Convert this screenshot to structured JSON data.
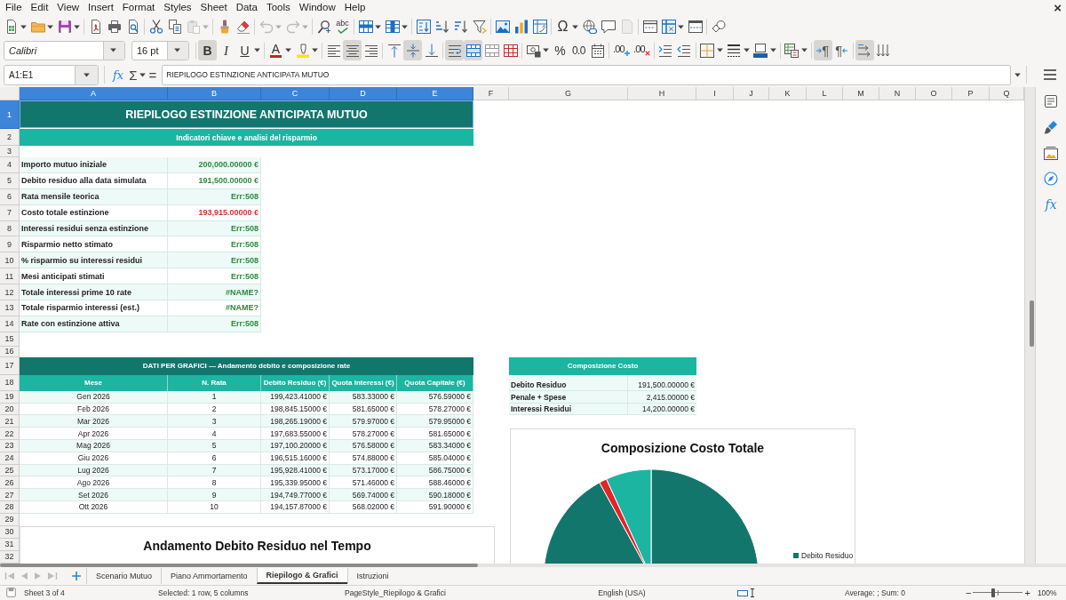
{
  "menu": {
    "items": [
      "File",
      "Edit",
      "View",
      "Insert",
      "Format",
      "Styles",
      "Sheet",
      "Data",
      "Tools",
      "Window",
      "Help"
    ],
    "close": "×"
  },
  "standard_toolbar": {
    "groups": [
      [
        {
          "kind": "new",
          "dropdown": true,
          "disabled": false
        },
        {
          "kind": "open",
          "dropdown": true,
          "disabled": false
        },
        {
          "kind": "save",
          "dropdown": true,
          "disabled": false
        }
      ],
      [
        {
          "kind": "pdf",
          "dropdown": false,
          "disabled": false
        },
        {
          "kind": "print",
          "dropdown": false,
          "disabled": false
        },
        {
          "kind": "preview",
          "dropdown": false,
          "disabled": false
        }
      ],
      [
        {
          "kind": "cut",
          "dropdown": false,
          "disabled": false
        },
        {
          "kind": "copy",
          "dropdown": false,
          "disabled": false
        },
        {
          "kind": "paste",
          "dropdown": true,
          "disabled": true
        }
      ],
      [
        {
          "kind": "clone",
          "dropdown": false,
          "disabled": false
        },
        {
          "kind": "clear",
          "dropdown": false,
          "disabled": false
        }
      ],
      [
        {
          "kind": "undo",
          "dropdown": true,
          "disabled": true
        },
        {
          "kind": "redo",
          "dropdown": true,
          "disabled": true
        }
      ],
      [
        {
          "kind": "find",
          "dropdown": false,
          "disabled": false
        },
        {
          "kind": "spell",
          "glyph": "abc",
          "dropdown": false,
          "disabled": false
        }
      ],
      [
        {
          "kind": "rows",
          "dropdown": true,
          "disabled": false
        },
        {
          "kind": "columns",
          "dropdown": true,
          "disabled": false
        }
      ],
      [
        {
          "kind": "sort",
          "dropdown": false,
          "disabled": false
        },
        {
          "kind": "sortasc",
          "dropdown": false,
          "disabled": false
        },
        {
          "kind": "sortdesc",
          "dropdown": false,
          "disabled": false
        },
        {
          "kind": "filter",
          "dropdown": false,
          "disabled": false
        }
      ],
      [
        {
          "kind": "image",
          "dropdown": false,
          "disabled": false
        },
        {
          "kind": "chart",
          "dropdown": false,
          "disabled": false
        },
        {
          "kind": "pivot",
          "dropdown": false,
          "disabled": false
        }
      ],
      [
        {
          "kind": "special",
          "glyph": "Ω",
          "dropdown": true,
          "disabled": false
        },
        {
          "kind": "link",
          "dropdown": false,
          "disabled": false
        },
        {
          "kind": "comment",
          "dropdown": false,
          "disabled": false
        },
        {
          "kind": "headerfooter",
          "dropdown": false,
          "disabled": true
        }
      ],
      [
        {
          "kind": "printarea",
          "dropdown": false,
          "disabled": false
        },
        {
          "kind": "freeze",
          "dropdown": true,
          "disabled": false
        },
        {
          "kind": "split",
          "dropdown": false,
          "disabled": false
        }
      ],
      [
        {
          "kind": "draw",
          "dropdown": false,
          "disabled": false
        }
      ]
    ]
  },
  "format_toolbar": {
    "font_name": "Calibri",
    "font_size": "16 pt",
    "groups": [
      [
        {
          "kind": "bold",
          "glyph": "B",
          "dropdown": false,
          "pressed": true
        },
        {
          "kind": "italic",
          "glyph": "I",
          "dropdown": false,
          "pressed": false
        },
        {
          "kind": "underline",
          "glyph": "U",
          "dropdown": true,
          "pressed": false
        }
      ],
      [
        {
          "kind": "fontcolor",
          "glyph": "A",
          "dropdown": true,
          "pressed": false
        },
        {
          "kind": "highlight",
          "dropdown": true,
          "pressed": false
        }
      ],
      [
        {
          "kind": "alignleft",
          "dropdown": false,
          "pressed": false
        },
        {
          "kind": "aligncenter",
          "dropdown": false,
          "pressed": true
        },
        {
          "kind": "alignright",
          "dropdown": false,
          "pressed": false
        }
      ],
      [
        {
          "kind": "aligntop",
          "dropdown": false,
          "pressed": false
        },
        {
          "kind": "alignmiddle",
          "dropdown": false,
          "pressed": true
        },
        {
          "kind": "alignbottom",
          "dropdown": false,
          "pressed": false
        }
      ],
      [
        {
          "kind": "wrap",
          "dropdown": false,
          "pressed": true
        },
        {
          "kind": "mergecenter",
          "dropdown": false,
          "pressed": true
        },
        {
          "kind": "merge",
          "dropdown": false,
          "pressed": false
        },
        {
          "kind": "unmerge",
          "dropdown": false,
          "pressed": false
        }
      ],
      [
        {
          "kind": "currency",
          "dropdown": true,
          "pressed": false
        },
        {
          "kind": "percent",
          "glyph": "%",
          "dropdown": false,
          "pressed": false
        },
        {
          "kind": "standard",
          "glyph": "0.0",
          "dropdown": false,
          "pressed": false
        },
        {
          "kind": "date",
          "dropdown": false,
          "pressed": false
        }
      ],
      [
        {
          "kind": "adddecimal",
          "glyph": ".00",
          "dropdown": false,
          "pressed": false
        },
        {
          "kind": "deletedecimal",
          "glyph": ".00",
          "dropdown": false,
          "pressed": false
        }
      ],
      [
        {
          "kind": "indent",
          "dropdown": false,
          "pressed": false
        },
        {
          "kind": "outdent",
          "dropdown": false,
          "pressed": false
        }
      ],
      [
        {
          "kind": "borders",
          "dropdown": true,
          "pressed": false
        },
        {
          "kind": "borderstyle",
          "dropdown": true,
          "pressed": false
        },
        {
          "kind": "bordercolor",
          "dropdown": true,
          "pressed": false
        }
      ],
      [
        {
          "kind": "conditional",
          "dropdown": true,
          "pressed": false
        }
      ],
      [
        {
          "kind": "ltr",
          "glyph": "¶",
          "dropdown": false,
          "pressed": true
        },
        {
          "kind": "rtl",
          "glyph": "¶",
          "dropdown": false,
          "pressed": false
        }
      ],
      [
        {
          "kind": "textltr",
          "dropdown": false,
          "pressed": true
        },
        {
          "kind": "texttb",
          "dropdown": false,
          "pressed": false
        }
      ]
    ]
  },
  "formula_bar": {
    "cell_reference": "A1:E1",
    "function_wizard": "fx",
    "sum": "Σ",
    "formula": "=",
    "content": "RIEPILOGO ESTINZIONE ANTICIPATA MUTUO"
  },
  "sheet": {
    "columns": [
      {
        "label": "A",
        "selected": true
      },
      {
        "label": "B",
        "selected": true
      },
      {
        "label": "C",
        "selected": true
      },
      {
        "label": "D",
        "selected": true
      },
      {
        "label": "E",
        "selected": true
      },
      {
        "label": "F",
        "selected": false
      },
      {
        "label": "G",
        "selected": false
      },
      {
        "label": "H",
        "selected": false
      },
      {
        "label": "I",
        "selected": false
      },
      {
        "label": "J",
        "selected": false
      },
      {
        "label": "K",
        "selected": false
      },
      {
        "label": "L",
        "selected": false
      },
      {
        "label": "M",
        "selected": false
      },
      {
        "label": "N",
        "selected": false
      },
      {
        "label": "O",
        "selected": false
      },
      {
        "label": "P",
        "selected": false
      },
      {
        "label": "Q",
        "selected": false
      }
    ],
    "rows": [
      {
        "label": "1",
        "selected": true
      },
      {
        "label": "2",
        "selected": false
      },
      {
        "label": "3",
        "selected": false
      },
      {
        "label": "4",
        "selected": false
      },
      {
        "label": "5",
        "selected": false
      },
      {
        "label": "6",
        "selected": false
      },
      {
        "label": "7",
        "selected": false
      },
      {
        "label": "8",
        "selected": false
      },
      {
        "label": "9",
        "selected": false
      },
      {
        "label": "10",
        "selected": false
      },
      {
        "label": "11",
        "selected": false
      },
      {
        "label": "12",
        "selected": false
      },
      {
        "label": "13",
        "selected": false
      },
      {
        "label": "14",
        "selected": false
      },
      {
        "label": "15",
        "selected": false
      },
      {
        "label": "16",
        "selected": false
      },
      {
        "label": "17",
        "selected": false
      },
      {
        "label": "18",
        "selected": false
      },
      {
        "label": "19",
        "selected": false
      },
      {
        "label": "20",
        "selected": false
      },
      {
        "label": "21",
        "selected": false
      },
      {
        "label": "22",
        "selected": false
      },
      {
        "label": "23",
        "selected": false
      },
      {
        "label": "24",
        "selected": false
      },
      {
        "label": "25",
        "selected": false
      },
      {
        "label": "26",
        "selected": false
      },
      {
        "label": "27",
        "selected": false
      },
      {
        "label": "28",
        "selected": false
      },
      {
        "label": "29",
        "selected": false
      },
      {
        "label": "30",
        "selected": false
      },
      {
        "label": "31",
        "selected": false
      },
      {
        "label": "32",
        "selected": false
      }
    ],
    "title": "RIEPILOGO ESTINZIONE ANTICIPATA MUTUO",
    "subtitle": "Indicatori chiave e analisi del risparmio",
    "summary": [
      {
        "label": "Importo mutuo iniziale",
        "value": "200,000.00000 €",
        "color": "#2b8a3e"
      },
      {
        "label": "Debito residuo alla data simulata",
        "value": "191,500.00000 €",
        "color": "#2b8a3e"
      },
      {
        "label": "Rata mensile teorica",
        "value": "Err:508",
        "color": "#2b8a3e"
      },
      {
        "label": "Costo totale estinzione",
        "value": "193,915.00000 €",
        "color": "#d9302c"
      },
      {
        "label": "Interessi residui senza estinzione",
        "value": "Err:508",
        "color": "#2b8a3e"
      },
      {
        "label": "Risparmio netto stimato",
        "value": "Err:508",
        "color": "#2b8a3e"
      },
      {
        "label": "% risparmio su interessi residui",
        "value": "Err:508",
        "color": "#2b8a3e"
      },
      {
        "label": "Mesi anticipati stimati",
        "value": "Err:508",
        "color": "#2b8a3e"
      },
      {
        "label": "Totale interessi prime 10 rate",
        "value": "#NAME?",
        "color": "#2b8a3e"
      },
      {
        "label": "Totale risparmio interessi (est.)",
        "value": "#NAME?",
        "color": "#2b8a3e"
      },
      {
        "label": "Rate con estinzione attiva",
        "value": "Err:508",
        "color": "#2b8a3e"
      }
    ],
    "chart_table": {
      "title": "DATI PER GRAFICI — Andamento debito e composizione rate",
      "columns": [
        "Mese",
        "N. Rata",
        "Debito Residuo (€)",
        "Quota Interessi (€)",
        "Quota Capitale (€)"
      ],
      "rows": [
        [
          "Gen 2026",
          "1",
          "199,423.41000 €",
          "583.33000 €",
          "576.59000 €"
        ],
        [
          "Feb 2026",
          "2",
          "198,845.15000 €",
          "581.65000 €",
          "578.27000 €"
        ],
        [
          "Mar 2026",
          "3",
          "198,265.19000 €",
          "579.97000 €",
          "579.95000 €"
        ],
        [
          "Apr 2026",
          "4",
          "197,683.55000 €",
          "578.27000 €",
          "581.65000 €"
        ],
        [
          "Mag 2026",
          "5",
          "197,100.20000 €",
          "576.58000 €",
          "583.34000 €"
        ],
        [
          "Giu 2026",
          "6",
          "196,515.16000 €",
          "574.88000 €",
          "585.04000 €"
        ],
        [
          "Lug 2026",
          "7",
          "195,928.41000 €",
          "573.17000 €",
          "586.75000 €"
        ],
        [
          "Ago 2026",
          "8",
          "195,339.95000 €",
          "571.46000 €",
          "588.46000 €"
        ],
        [
          "Set 2026",
          "9",
          "194,749.77000 €",
          "569.74000 €",
          "590.18000 €"
        ],
        [
          "Ott 2026",
          "10",
          "194,157.87000 €",
          "568.02000 €",
          "591.90000 €"
        ]
      ]
    },
    "cost_table": {
      "title": "Composizione Costo",
      "rows": [
        {
          "label": "Debito Residuo",
          "value": "191,500.00000 €"
        },
        {
          "label": "Penale + Spese",
          "value": "2,415.00000 €"
        },
        {
          "label": "Interessi Residui",
          "value": "14,200.00000 €"
        }
      ]
    },
    "line_chart": {
      "title": "Andamento Debito Residuo nel Tempo"
    },
    "pie_chart": {
      "title": "Composizione Costo Totale",
      "legend": [
        {
          "label": "Debito Residuo",
          "color": "#13766c"
        }
      ]
    }
  },
  "sidebar": [
    {
      "kind": "properties"
    },
    {
      "kind": "styles"
    },
    {
      "kind": "gallery"
    },
    {
      "kind": "navigator"
    },
    {
      "kind": "functions",
      "glyph": "fx"
    }
  ],
  "sheet_navigation": {
    "disabled": true
  },
  "sheet_tabs": [
    {
      "label": "Scenario Mutuo",
      "selected": false
    },
    {
      "label": "Piano Ammortamento",
      "selected": false
    },
    {
      "label": "Riepilogo & Grafici",
      "selected": true
    },
    {
      "label": "Istruzioni",
      "selected": false
    }
  ],
  "status_bar": {
    "sheet": "Sheet 3 of 4",
    "selection": "Selected: 1 row, 5 columns",
    "page_style": "PageStyle_Riepilogo & Grafici",
    "language": "English (USA)",
    "summary": "Average: ; Sum: 0",
    "zoom_out": "−",
    "zoom": {
      "level": 0.4
    },
    "zoom_in": "+",
    "zoom_percent": "100%"
  }
}
